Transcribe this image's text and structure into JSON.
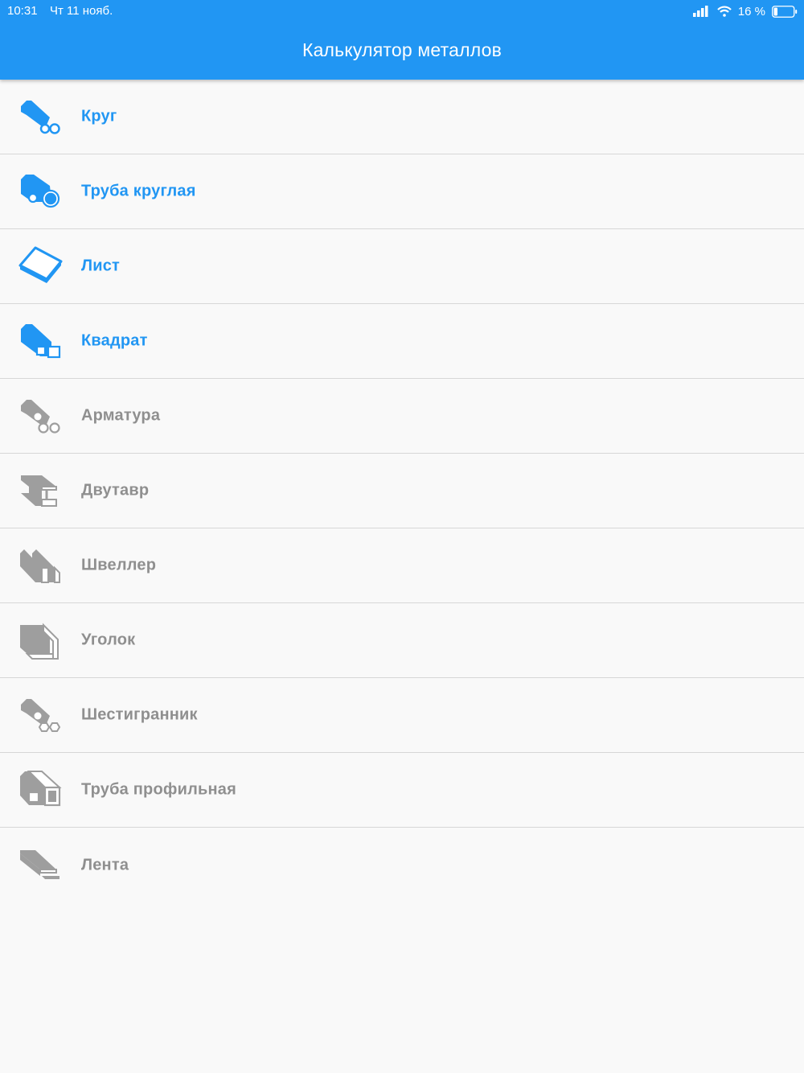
{
  "status_bar": {
    "time": "10:31",
    "date": "Чт 11 нояб.",
    "battery": "16 %",
    "icons": [
      "signal-icon",
      "wifi-icon",
      "battery-icon"
    ]
  },
  "header": {
    "title": "Калькулятор металлов",
    "color": "#2196f3"
  },
  "colors": {
    "active": "#2196f3",
    "inactive": "#8f8f8f"
  },
  "items": [
    {
      "label": "Круг",
      "icon": "round-bar-icon",
      "active": true
    },
    {
      "label": "Труба круглая",
      "icon": "round-pipe-icon",
      "active": true
    },
    {
      "label": "Лист",
      "icon": "sheet-icon",
      "active": true
    },
    {
      "label": "Квадрат",
      "icon": "square-bar-icon",
      "active": true
    },
    {
      "label": "Арматура",
      "icon": "rebar-icon",
      "active": false
    },
    {
      "label": "Двутавр",
      "icon": "i-beam-icon",
      "active": false
    },
    {
      "label": "Швеллер",
      "icon": "channel-icon",
      "active": false
    },
    {
      "label": "Уголок",
      "icon": "angle-icon",
      "active": false
    },
    {
      "label": "Шестигранник",
      "icon": "hexagon-bar-icon",
      "active": false
    },
    {
      "label": "Труба профильная",
      "icon": "profile-pipe-icon",
      "active": false
    },
    {
      "label": "Лента",
      "icon": "strip-icon",
      "active": false
    }
  ]
}
